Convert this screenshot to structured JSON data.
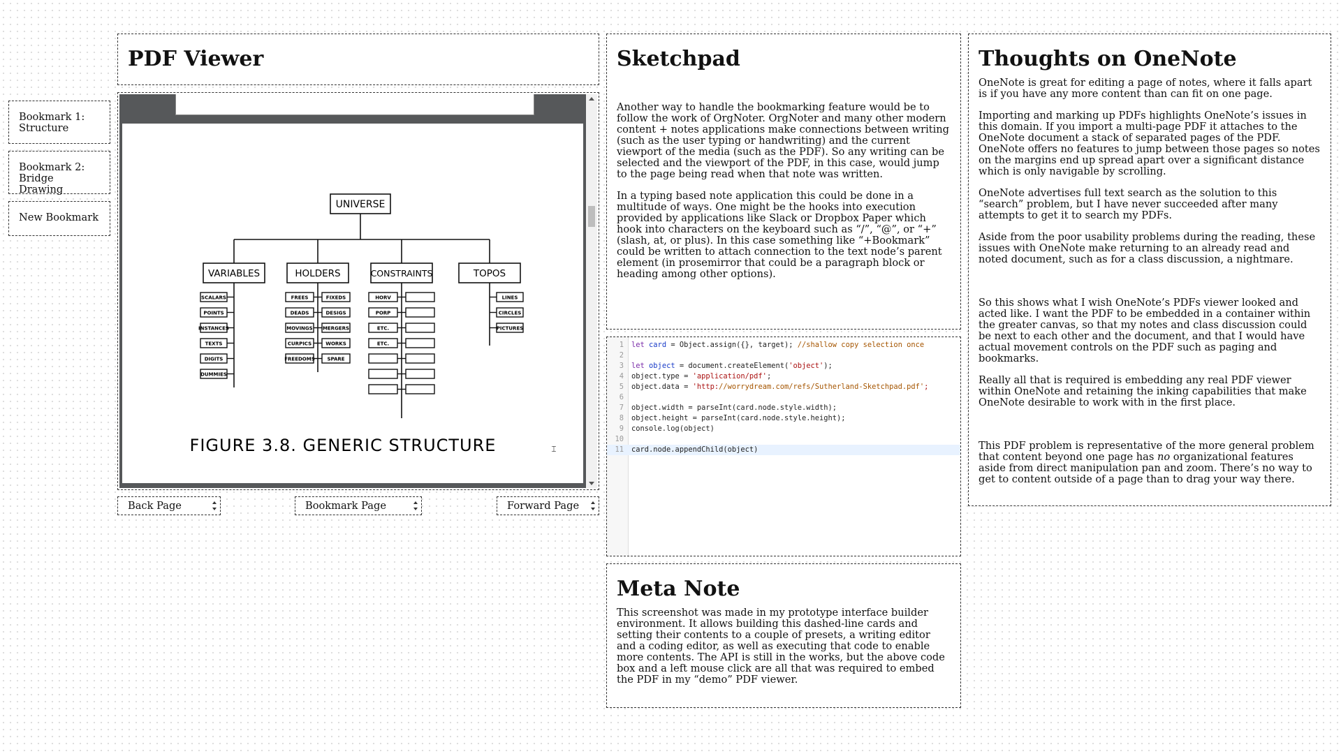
{
  "bookmarks": [
    {
      "label": "Bookmark 1: Structure"
    },
    {
      "label": "Bookmark 2: Bridge Drawing"
    },
    {
      "label": "New Bookmark"
    }
  ],
  "pdf_viewer": {
    "title": "PDF Viewer",
    "buttons": {
      "back": "Back Page",
      "bookmark": "Bookmark Page",
      "forward": "Forward Page"
    },
    "page": {
      "root": "UNIVERSE",
      "groups": [
        {
          "label": "VARIABLES",
          "items": [
            "SCALARS",
            "POINTS",
            "INSTANCES",
            "TEXTS",
            "DIGITS",
            "DUMMIES"
          ]
        },
        {
          "label": "HOLDERS",
          "items_left": [
            "FREES",
            "DEADS",
            "MOVINGS",
            "CURPICS",
            "FREEDOMS"
          ],
          "items_right": [
            "FIXEDS",
            "DESIGS",
            "MERGERS",
            "WORKS",
            "SPARE"
          ]
        },
        {
          "label": "CONSTRAINTS",
          "items_left": [
            "HORV",
            "PORP",
            "ETC.",
            "ETC.",
            "",
            "",
            ""
          ],
          "items_right": [
            "",
            "",
            "",
            "",
            "",
            "",
            ""
          ]
        },
        {
          "label": "TOPOS",
          "items": [
            "LINES",
            "CIRCLES",
            "PICTURES"
          ]
        }
      ],
      "caption": "FIGURE 3.8.  GENERIC STRUCTURE"
    }
  },
  "sketchpad": {
    "title": "Sketchpad",
    "paragraphs": [
      "Another way to handle the bookmarking feature would be to follow the work of OrgNoter. OrgNoter and many other modern content + notes applications make connections between writing (such as the user typing or handwriting) and the current viewport of the media (such as the PDF). So any writing can be selected and the viewport of the PDF, in this case, would jump to the page being read when that note was written.",
      "In a typing based note application this could be done in a multitude of ways. One might be the hooks into execution provided by applications like Slack or Dropbox Paper which hook into characters on the keyboard such as “/”, “@”, or “+” (slash, at, or plus). In this case something like “+Bookmark” could be written to attach connection to the text node’s parent element (in prosemirror that could be a paragraph block or heading among other options)."
    ]
  },
  "code_editor": {
    "lines": [
      "let card = Object.assign({}, target); //shallow copy selection once",
      "",
      "let object = document.createElement('object');",
      "object.type = 'application/pdf';",
      "object.data = 'http://worrydream.com/refs/Sutherland-Sketchpad.pdf';",
      "",
      "object.width = parseInt(card.node.style.width);",
      "object.height = parseInt(card.node.style.height);",
      "console.log(object)",
      "",
      "card.node.appendChild(object)"
    ],
    "active_line": 11
  },
  "meta_note": {
    "title": "Meta Note",
    "text": "This screenshot was made in my prototype interface builder environment. It allows building this dashed-line cards and setting their contents to a couple of presets, a writing editor and a coding editor, as well as executing that code to enable more contents. The API is still in the works, but the above code box and a left mouse click are all that was required to embed the PDF in my “demo” PDF viewer."
  },
  "onenote": {
    "title": "Thoughts on OneNote",
    "paragraphs_top": [
      "OneNote is great for editing a page of notes, where it falls apart is if you have any more content than can fit on one page.",
      "Importing and marking up PDFs highlights OneNote’s issues in this domain. If you import a multi-page PDF it attaches to the OneNote document a stack of separated pages of the PDF. OneNote offers no features to jump between those pages so notes on the margins end up spread apart over a significant distance which is only navigable by scrolling.",
      "OneNote advertises full text search as the solution to this “search” problem, but I have never succeeded after many attempts to get it to search my PDFs.",
      "Aside from the poor usability problems during the reading, these issues with OneNote make returning to an already read and noted document, such as for a class discussion, a nightmare."
    ],
    "paragraphs_mid": [
      "So this shows what I wish OneNote’s PDFs viewer looked and acted like. I want the PDF to be embedded in a container within the greater canvas, so that my notes and class discussion could be next to each other and the document, and that I would have actual movement controls on the PDF such as paging and bookmarks.",
      "Really all that is required is embedding any real PDF viewer within OneNote and retaining the inking capabilities that make OneNote desirable to work with in the first place."
    ],
    "last_para": {
      "before": "This PDF problem is representative of the more general problem that content beyond one page has ",
      "emph": "no",
      "after": " organizational features aside from direct manipulation pan and zoom. There’s no way to get to content outside of a page than to drag your way there."
    }
  }
}
